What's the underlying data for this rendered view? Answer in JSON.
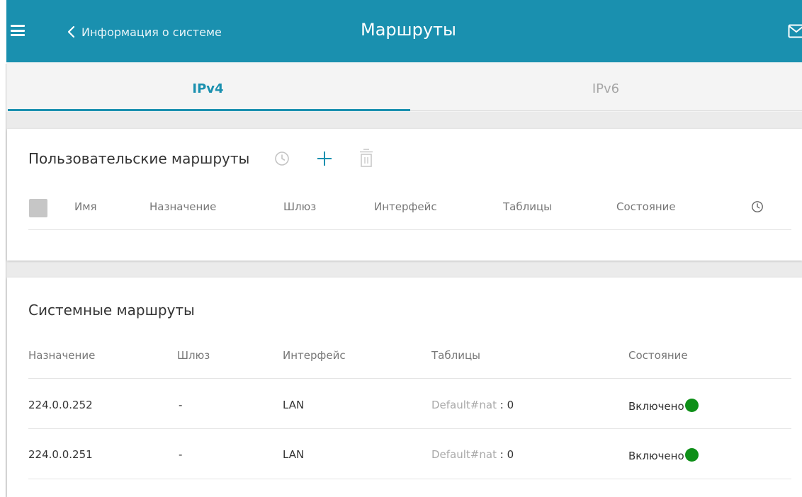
{
  "header": {
    "back_label": "Информация о системе",
    "title": "Маршруты",
    "background_color": "#1a90af"
  },
  "icons": {
    "menu": "hamburger-menu",
    "back": "chevron-left",
    "mail": "envelope",
    "history": "clock",
    "add": "plus",
    "delete": "trash"
  },
  "tabs": [
    {
      "label": "IPv4",
      "active": true
    },
    {
      "label": "IPv6",
      "active": false
    }
  ],
  "user_routes": {
    "title": "Пользовательские маршруты",
    "columns": [
      "Имя",
      "Назначение",
      "Шлюз",
      "Интерфейс",
      "Таблицы",
      "Состояние"
    ],
    "rows": []
  },
  "system_routes": {
    "title": "Системные маршруты",
    "columns": [
      "Назначение",
      "Шлюз",
      "Интерфейс",
      "Таблицы",
      "Состояние"
    ],
    "rows": [
      {
        "destination": "224.0.0.252",
        "gateway": "-",
        "interface": "LAN",
        "table": "Default#nat",
        "table_value": ": 0",
        "status": "Включено"
      },
      {
        "destination": "224.0.0.251",
        "gateway": "-",
        "interface": "LAN",
        "table": "Default#nat",
        "table_value": ": 0",
        "status": "Включено"
      }
    ]
  },
  "colors": {
    "accent": "#1a90af",
    "status_enabled": "#0e8f18"
  }
}
